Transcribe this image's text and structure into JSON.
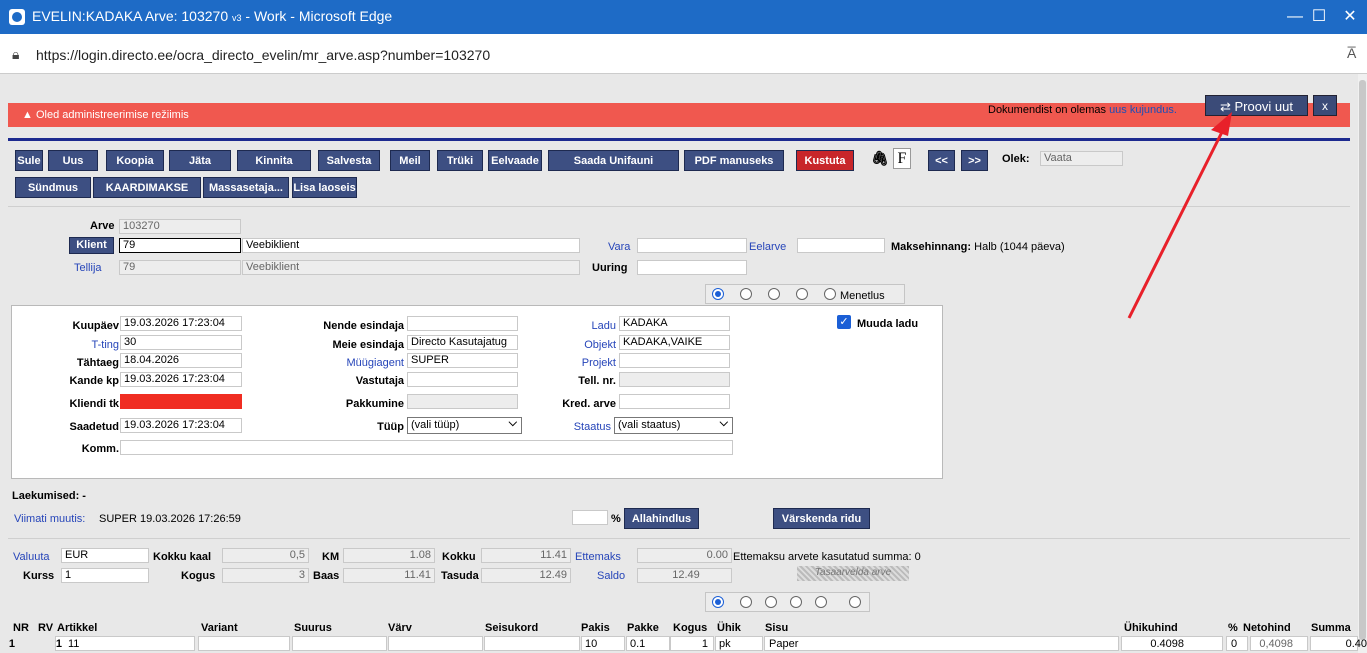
{
  "window": {
    "title": "EVELIN:KADAKA Arve: 103270 ",
    "title_sub": "v3",
    "title_tail": " - Work - Microsoft Edge",
    "minimize": "—",
    "maximize": "☐",
    "close": "✕"
  },
  "address": {
    "url": "https://login.directo.ee/ocra_directo_evelin/mr_arve.asp?number=103270",
    "read_aloud": "A̅"
  },
  "banner": {
    "admin_mode": "Oled administreerimise režiimis",
    "notice_prefix": "Dokumendist on olemas ",
    "notice_link": "uus kujundus.",
    "try_new": "⇄ Proovi uut",
    "close": "x"
  },
  "toolbar": {
    "row1": [
      "Sule",
      "Uus",
      "Koopia",
      "Jäta",
      "Kinnita",
      "Salvesta",
      "Meil",
      "Trüki",
      "Eelvaade",
      "Saada Unifauni",
      "PDF manuseks",
      "Kustuta"
    ],
    "row2": [
      "Sündmus",
      "KAARDIMAKSE",
      "Massasetaja...",
      "Lisa laoseis"
    ],
    "attach_icon": "📎",
    "f_icon": "F",
    "prev": "<<",
    "next": ">>",
    "status_label": "Olek:",
    "status_value": "Vaata"
  },
  "header": {
    "arve_label": "Arve",
    "arve_value": "103270",
    "klient_button": "Klient",
    "klient_value": "79",
    "klient_name": "Veebiklient",
    "tellija_label": "Tellija",
    "tellija_value": "79",
    "tellija_name": "Veebiklient",
    "vara_label": "Vara",
    "eelarve_label": "Eelarve",
    "uuring_label": "Uuring",
    "makse_label": "Maksehinnang:",
    "makse_value": "Halb (1044 päeva)",
    "menetlus_label": "Menetlus"
  },
  "form": {
    "kuupaev_label": "Kuupäev",
    "kuupaev": "19.03.2026 17:23:04",
    "tting_label": "T-ting",
    "tting": "30",
    "tahtaeg_label": "Tähtaeg",
    "tahtaeg": "18.04.2026",
    "kande_label": "Kande kp",
    "kande": "19.03.2026 17:23:04",
    "kliendi_tk_label": "Kliendi tk",
    "saadetud_label": "Saadetud",
    "saadetud": "19.03.2026 17:23:04",
    "komm_label": "Komm.",
    "nende_label": "Nende esindaja",
    "meie_label": "Meie esindaja",
    "meie": "Directo Kasutajatug",
    "muugi_label": "Müügiagent",
    "muugi": "SUPER",
    "vastutaja_label": "Vastutaja",
    "pakkumine_label": "Pakkumine",
    "tuup_label": "Tüüp",
    "tuup": "(vali tüüp)",
    "ladu_label": "Ladu",
    "ladu": "KADAKA",
    "objekt_label": "Objekt",
    "objekt": "KADAKA,VAIKE",
    "projekt_label": "Projekt",
    "tell_label": "Tell. nr.",
    "kred_label": "Kred. arve",
    "staatus_label": "Staatus",
    "staatus": "(vali staatus)",
    "muuda_ladu": "Muuda ladu",
    "check": "✓"
  },
  "summary": {
    "laekumised": "Laekumised: -",
    "viimati_label": "Viimati muutis:",
    "viimati_value": "SUPER 19.03.2026 17:26:59",
    "percent": "%",
    "allahindlus": "Allahindlus",
    "varskenda": "Värskenda ridu",
    "valuuta_label": "Valuuta",
    "valuuta": "EUR",
    "kurss_label": "Kurss",
    "kurss": "1",
    "kaal_label": "Kokku kaal",
    "kaal": "0,5",
    "kogus_label": "Kogus",
    "kogus": "3",
    "km_label": "KM",
    "km": "1.08",
    "baas_label": "Baas",
    "baas": "11.41",
    "kokku_label": "Kokku",
    "kokku": "11.41",
    "tasuda_label": "Tasuda",
    "tasuda": "12.49",
    "ettemaks_label": "Ettemaks",
    "ettemaks": "0.00",
    "ettemaks_text": "Ettemaksu arvete kasutatud summa: 0",
    "saldo_label": "Saldo",
    "saldo": "12.49",
    "tasaarvelda": "Tasaarvelda arve"
  },
  "table": {
    "headers": [
      "NR",
      "RV",
      "Artikkel",
      "Variant",
      "Suurus",
      "Värv",
      "Seisukord",
      "Pakis",
      "Pakke",
      "Kogus",
      "Ühik",
      "Sisu",
      "Ühikuhind",
      "%",
      "Netohind",
      "Summa"
    ],
    "rows": [
      {
        "nr": "1",
        "rv": "1",
        "artikkel": "11",
        "pakis": "10",
        "pakke": "0.1",
        "kogus": "1",
        "uhik": "pk",
        "sisu": "Paper",
        "uhikuhind": "0.4098",
        "pct": "0",
        "netohind": "0,4098",
        "summa": "0.40"
      }
    ]
  },
  "annotation_color": "#e8202a"
}
